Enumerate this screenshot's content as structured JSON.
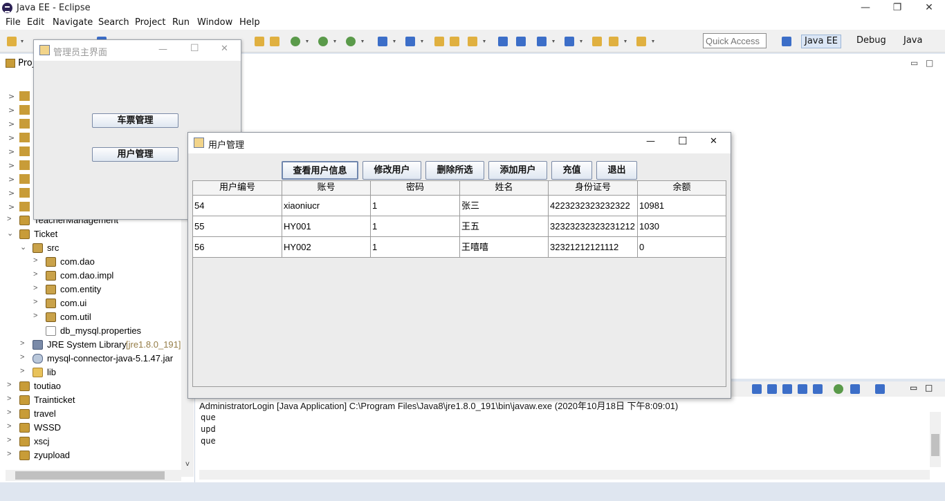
{
  "app": {
    "title": "Java EE - Eclipse"
  },
  "window_controls": {
    "minimize": "—",
    "restore": "❐",
    "close": "✕"
  },
  "menu": [
    "File",
    "Edit",
    "Navigate",
    "Search",
    "Project",
    "Run",
    "Window",
    "Help"
  ],
  "quick_access": {
    "placeholder": "Quick Access"
  },
  "perspectives": [
    "Java EE",
    "Debug",
    "Java"
  ],
  "project_explorer": {
    "tab_label": "Proj",
    "items": [
      {
        "label": "TeacherManagement",
        "icon": "project-icon",
        "depth": 0,
        "expanded": false
      },
      {
        "label": "Ticket",
        "icon": "project-icon",
        "depth": 0,
        "expanded": true
      },
      {
        "label": "src",
        "icon": "source-folder-icon",
        "depth": 1,
        "expanded": true
      },
      {
        "label": "com.dao",
        "icon": "package-icon",
        "depth": 2,
        "expanded": false
      },
      {
        "label": "com.dao.impl",
        "icon": "package-icon",
        "depth": 2,
        "expanded": false
      },
      {
        "label": "com.entity",
        "icon": "package-icon",
        "depth": 2,
        "expanded": false
      },
      {
        "label": "com.ui",
        "icon": "package-icon",
        "depth": 2,
        "expanded": false
      },
      {
        "label": "com.util",
        "icon": "package-icon",
        "depth": 2,
        "expanded": false
      },
      {
        "label": "db_mysql.properties",
        "icon": "file-icon",
        "depth": 2,
        "expanded": null
      },
      {
        "label": "JRE System Library",
        "suffix": "[jre1.8.0_191]",
        "icon": "library-icon",
        "depth": 1,
        "expanded": false
      },
      {
        "label": "mysql-connector-java-5.1.47.jar",
        "icon": "jar-icon",
        "depth": 1,
        "expanded": false
      },
      {
        "label": "lib",
        "icon": "folder-icon",
        "depth": 1,
        "expanded": false
      },
      {
        "label": "toutiao",
        "icon": "project-icon",
        "depth": 0,
        "expanded": false
      },
      {
        "label": "Trainticket",
        "icon": "project-icon",
        "depth": 0,
        "expanded": false
      },
      {
        "label": "travel",
        "icon": "project-icon",
        "depth": 0,
        "expanded": false
      },
      {
        "label": "WSSD",
        "icon": "project-icon",
        "depth": 0,
        "expanded": false
      },
      {
        "label": "xscj",
        "icon": "project-icon",
        "depth": 0,
        "expanded": false
      },
      {
        "label": "zyupload",
        "icon": "project-icon",
        "depth": 0,
        "expanded": false
      }
    ]
  },
  "console": {
    "header": "AdministratorLogin [Java Application] C:\\Program Files\\Java8\\jre1.8.0_191\\bin\\javaw.exe (2020年10月18日 下午8:09:01)",
    "lines": [
      "que",
      "upd",
      "que"
    ]
  },
  "admin_window": {
    "title": "管理员主界面",
    "buttons": [
      "车票管理",
      "用户管理"
    ]
  },
  "user_window": {
    "title": "用户管理",
    "buttons": [
      "查看用户信息",
      "修改用户",
      "删除所选",
      "添加用户",
      "充值",
      "退出"
    ],
    "table": {
      "headers": [
        "用户编号",
        "账号",
        "密码",
        "姓名",
        "身份证号",
        "余额"
      ],
      "rows": [
        [
          "54",
          "xiaoniucr",
          "1",
          "张三",
          "4223232323232322",
          "10981"
        ],
        [
          "55",
          "HY001",
          "1",
          "王五",
          "32323232323231212",
          "1030"
        ],
        [
          "56",
          "HY002",
          "1",
          "王嘻嘻",
          "32321212121112",
          "0"
        ]
      ]
    }
  }
}
